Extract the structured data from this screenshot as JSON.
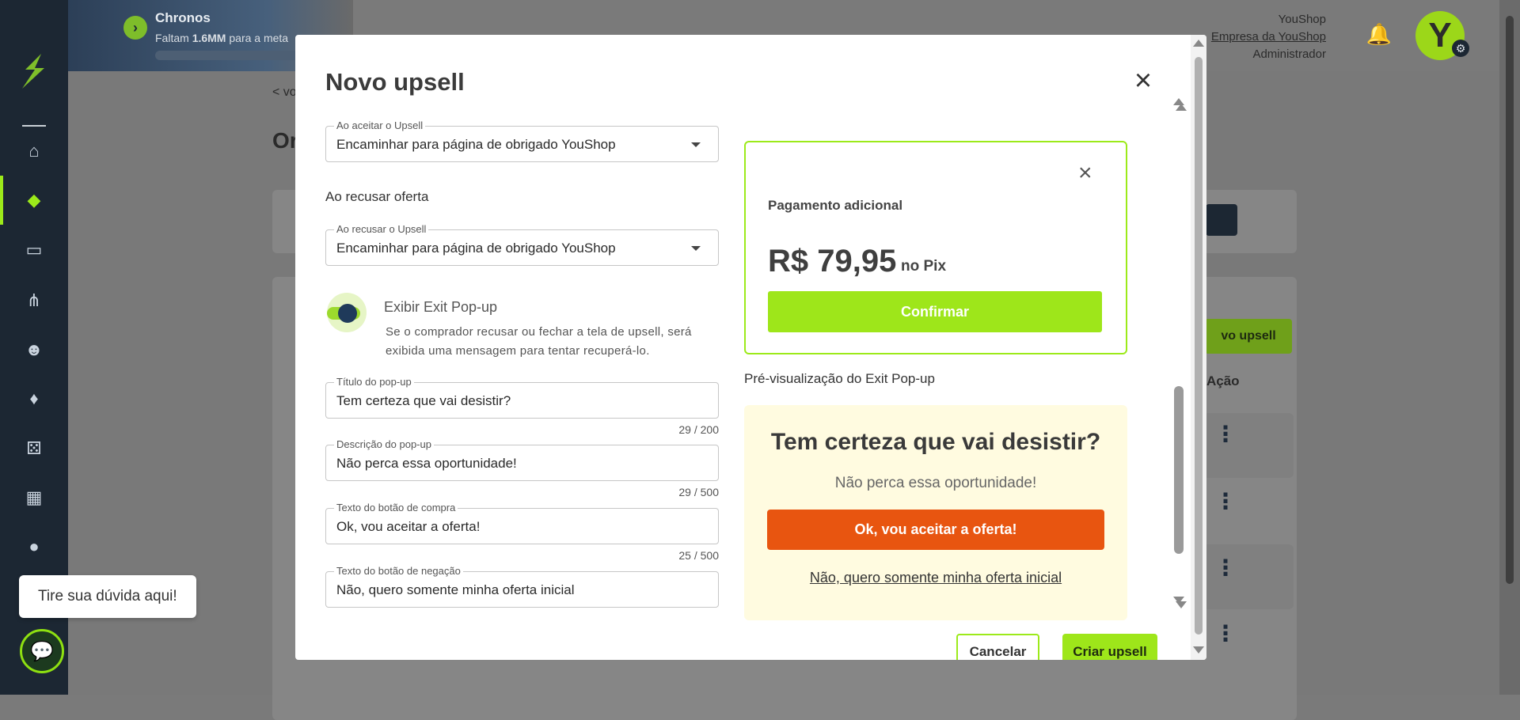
{
  "promo": {
    "name": "Chronos",
    "prefix": "Faltam",
    "amount": "1.6MM",
    "suffix": "para a meta"
  },
  "user": {
    "name": "YouShop",
    "company": "Empresa da YouShop",
    "role": "Administrador",
    "avatar_initial": "Y"
  },
  "background": {
    "back_link": "< vo",
    "heading_partial": "Or",
    "new_upsell_partial": "vo upsell",
    "action_partial": "Ação"
  },
  "help": {
    "bubble_text": "Tire sua dúvida aqui!"
  },
  "modal": {
    "title": "Novo upsell",
    "accept_field": {
      "label": "Ao aceitar o Upsell",
      "value": "Encaminhar para página de obrigado YouShop"
    },
    "decline_section_label": "Ao recusar oferta",
    "decline_field": {
      "label": "Ao recusar o Upsell",
      "value": "Encaminhar para página de obrigado YouShop"
    },
    "exit_toggle": {
      "label": "Exibir Exit Pop-up",
      "on": true,
      "help": "Se o comprador recusar ou fechar a tela de upsell, será exibida uma mensagem para tentar recuperá-lo."
    },
    "popup_title": {
      "label": "Título do pop-up",
      "value": "Tem certeza que vai desistir?",
      "counter": "29 / 200"
    },
    "popup_description": {
      "label": "Descrição do pop-up",
      "value": "Não perca essa oportunidade!",
      "counter": "29 / 500"
    },
    "buy_button_text": {
      "label": "Texto do botão de compra",
      "value": "Ok, vou aceitar a oferta!",
      "counter": "25 / 500"
    },
    "decline_button_text": {
      "label": "Texto do botão de negação",
      "value": "Não, quero somente minha oferta inicial"
    },
    "offer_preview": {
      "title": "Pagamento adicional",
      "price": "R$ 79,95",
      "price_suffix": "no Pix",
      "confirm_label": "Confirmar"
    },
    "exit_preview": {
      "section_title": "Pré-visualização do Exit Pop-up",
      "heading": "Tem certeza que vai desistir?",
      "description": "Não perca essa oportunidade!",
      "accept_label": "Ok, vou aceitar a oferta!",
      "decline_label": "Não, quero somente minha oferta inicial"
    },
    "cancel_label": "Cancelar",
    "create_label": "Criar upsell"
  },
  "colors": {
    "brand_green": "#9ee61a",
    "sidebar": "#1c2733",
    "accept_orange": "#e85510",
    "exit_bg": "#fffbe0"
  }
}
